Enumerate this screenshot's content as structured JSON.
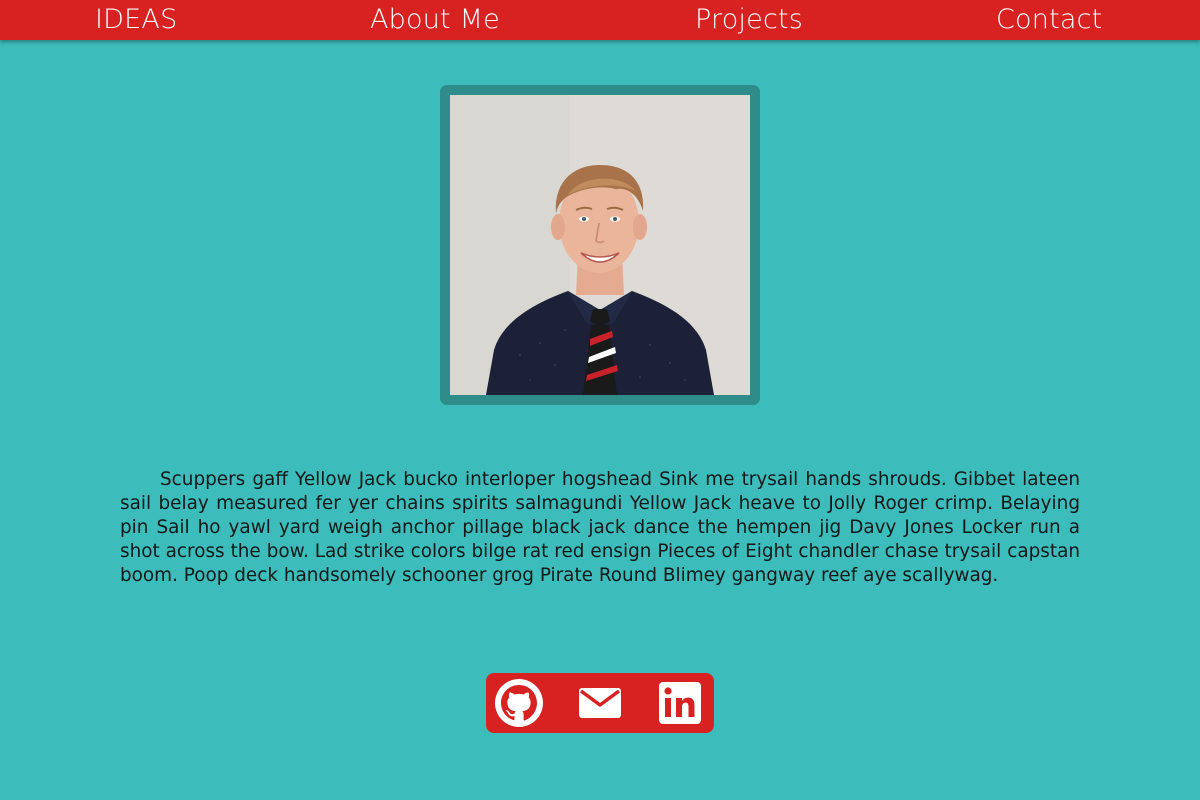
{
  "nav": {
    "items": [
      {
        "label": "IDEAS"
      },
      {
        "label": "About Me"
      },
      {
        "label": "Projects"
      },
      {
        "label": "Contact"
      }
    ]
  },
  "profile": {
    "photo_icon": "portrait-photo"
  },
  "bio": {
    "text": "Scuppers gaff Yellow Jack bucko interloper hogshead Sink me trysail hands shrouds. Gibbet lateen sail belay measured fer yer chains spirits salmagundi Yellow Jack heave to Jolly Roger crimp. Belaying pin Sail ho yawl yard weigh anchor pillage black jack dance the hempen jig Davy Jones Locker run a shot across the bow. Lad strike colors bilge rat red ensign Pieces of Eight chandler chase trysail capstan boom. Poop deck handsomely schooner grog Pirate Round Blimey gangway reef aye scallywag."
  },
  "social": {
    "icons": [
      "github-icon",
      "email-icon",
      "linkedin-icon"
    ]
  },
  "colors": {
    "background": "#3dbcbc",
    "navbar": "#d82222",
    "photo_frame": "#2e8c8a",
    "social_bar": "#d82222",
    "text": "#101818"
  }
}
